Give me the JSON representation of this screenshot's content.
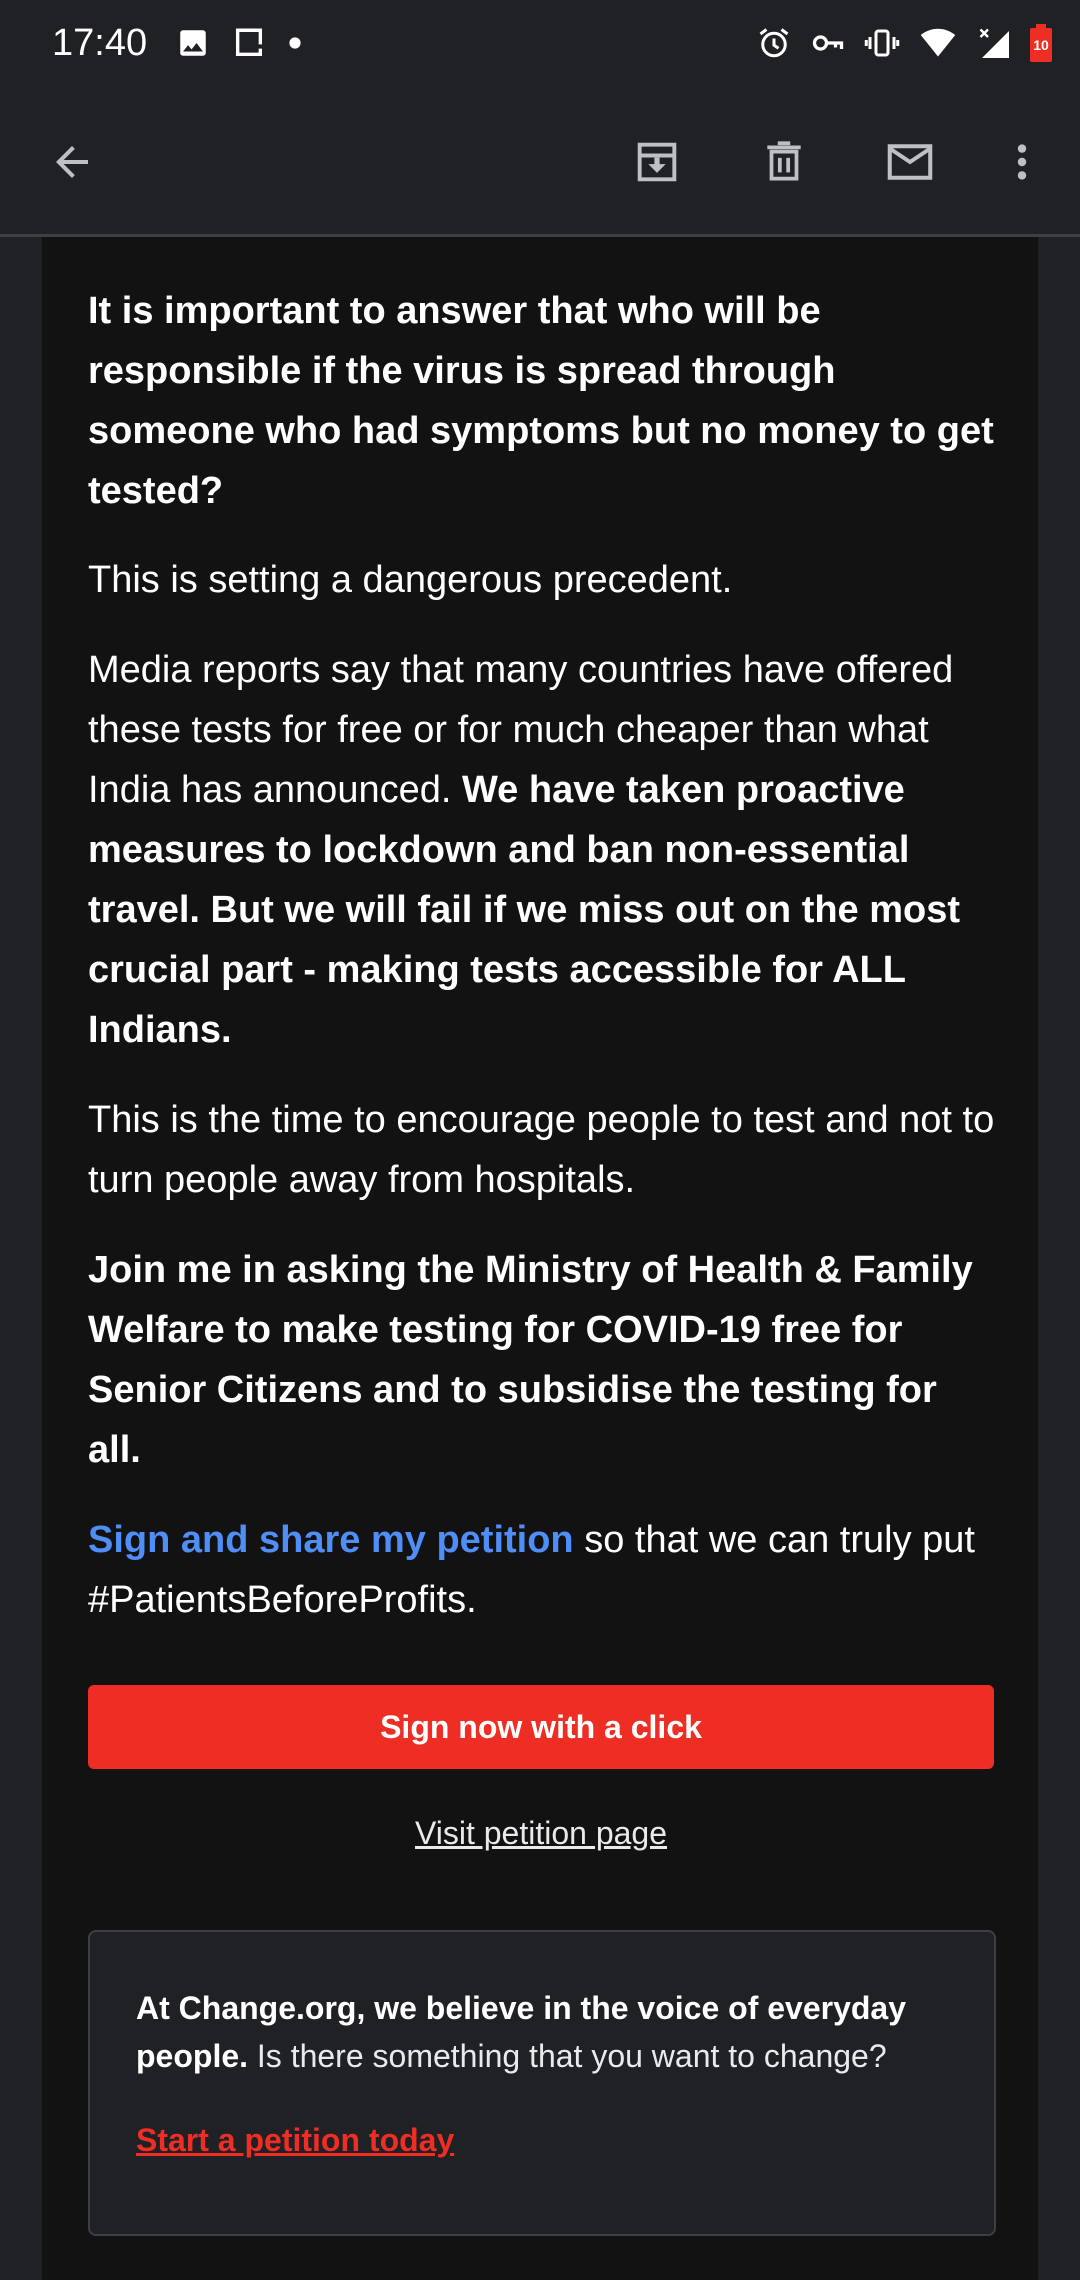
{
  "status_bar": {
    "time": "17:40",
    "left_icons": [
      "image-icon",
      "screenshot-icon",
      "dot-icon"
    ],
    "right_icons": [
      "alarm-icon",
      "vpn-key-icon",
      "vibrate-icon",
      "wifi-icon",
      "signal-icon",
      "battery-icon"
    ],
    "battery_level": "10"
  },
  "toolbar": {
    "back_icon": "arrow-back-icon",
    "archive_icon": "archive-icon",
    "delete_icon": "delete-icon",
    "mark_unread_icon": "mail-icon",
    "more_icon": "more-vert-icon"
  },
  "email": {
    "para1_bold": "It is important to answer that who will be responsible if the virus is spread through someone who had symptoms but no money to get tested?",
    "para2": "This is setting a dangerous precedent.",
    "para3_normal": "Media reports say that many countries have offered these tests for free or for much cheaper than what India has announced. ",
    "para3_bold": "We have taken proactive measures to lockdown and ban non-essential travel. But we will fail if we miss out on the most crucial part - making tests accessible for ALL Indians.",
    "para4": "This is the time to encourage people to test and not to turn people away from hospitals.",
    "para5_bold": "Join me in asking the Ministry of Health & Family Welfare to make testing for COVID-19 free for Senior Citizens and to subsidise the testing for all.",
    "para6_link": "Sign and share my petition",
    "para6_rest": " so that we can truly put #PatientsBeforeProfits.",
    "cta_label": "Sign now with a click",
    "visit_label": "Visit petition page",
    "box_bold": "At Change.org, we believe in the voice of everyday people.",
    "box_normal": " Is there something that you want to change?",
    "box_link": "Start a petition today"
  },
  "colors": {
    "accent_red": "#ee2e24",
    "link_blue": "#4f8ef7",
    "background": "#202124",
    "card": "#121212"
  }
}
